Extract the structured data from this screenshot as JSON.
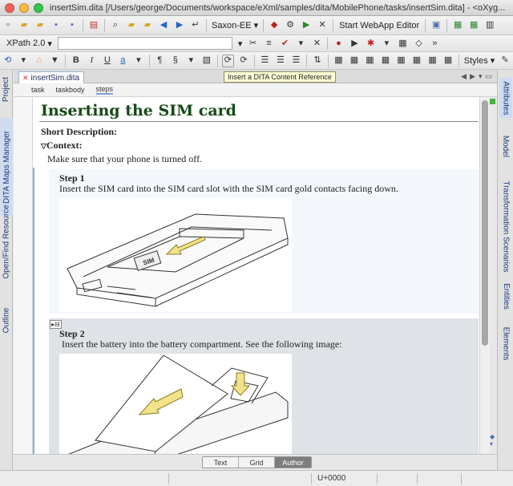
{
  "window": {
    "title": "insertSim.dita [/Users/george/Documents/workspace/eXml/samples/dita/MobilePhone/tasks/insertSim.dita] - <oXyg..."
  },
  "toolbar1": {
    "transformer": "Saxon-EE",
    "webapp_button": "Start WebApp Editor"
  },
  "toolbar2": {
    "xpath_label": "XPath 2.0"
  },
  "toolbar3": {
    "styles_label": "Styles"
  },
  "tooltip": "Insert a DITA Content Reference",
  "editor_tab": {
    "label": "insertSim.dita"
  },
  "breadcrumb": [
    "task",
    "taskbody",
    "steps"
  ],
  "left_rail": [
    "Project",
    "DITA Maps Manager",
    "Open/Find Resource",
    "Outline"
  ],
  "right_rail": [
    "Attributes",
    "Model",
    "Transformation Scenarios",
    "Entities",
    "Elements"
  ],
  "document": {
    "title": "Inserting the SIM card",
    "short_desc_label": "Short Description:",
    "context_label": "Context:",
    "context_text": "Make sure that your phone is turned off.",
    "steps": [
      {
        "label": "Step 1",
        "text": "Insert the SIM card into the SIM card slot with the SIM card gold contacts facing down."
      },
      {
        "label": "Step 2",
        "text": "Insert the battery into the battery compartment. See the following image:"
      }
    ],
    "sim_label": "SIM"
  },
  "modes": {
    "items": [
      "Text",
      "Grid",
      "Author"
    ],
    "active": "Author"
  },
  "status": {
    "unicode": "U+0000"
  }
}
